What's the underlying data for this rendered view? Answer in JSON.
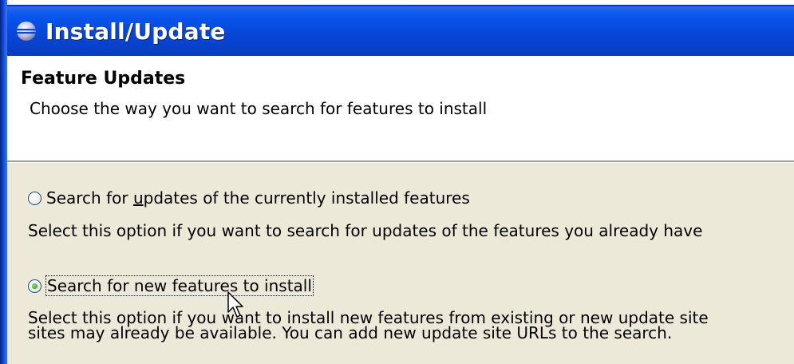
{
  "window": {
    "title": "Install/Update",
    "icon": "eclipse-icon"
  },
  "header": {
    "title": "Feature Updates",
    "description": "Choose the way you want to search for features to install"
  },
  "options": [
    {
      "label_prefix": "Search for ",
      "label_mnemonic": "u",
      "label_suffix": "pdates of the currently installed features",
      "checked": false,
      "description_lines": [
        "Select this option if you want to search for updates of the features you already have"
      ]
    },
    {
      "label": "Search for new features to install",
      "checked": true,
      "focused": true,
      "description_lines": [
        "Select this option if you want to install new features from existing or new update site",
        "sites may already be available. You can add new update site URLs to the search."
      ]
    }
  ],
  "colors": {
    "titlebar": "#0a58f0",
    "dialog_background": "#ece9d8",
    "radio_checked": "#3fb12a"
  }
}
